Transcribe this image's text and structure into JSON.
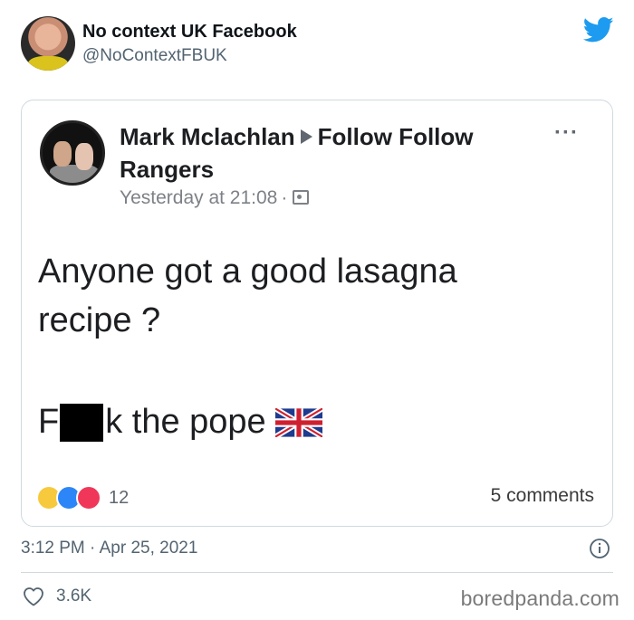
{
  "tweet": {
    "author_name": "No context UK Facebook",
    "author_handle": "@NoContextFBUK",
    "timestamp": "3:12 PM · Apr 25, 2021",
    "likes": "3.6K",
    "brand_color": "#1d9bf0"
  },
  "fb_post": {
    "poster_name": "Mark Mclachlan",
    "group_name": "Follow Follow Rangers",
    "more_label": "···",
    "time": "Yesterday at 21:08",
    "time_separator": "·",
    "text_line1": "Anyone got a good lasagna",
    "text_line2": "recipe ?",
    "text_line3_start": "F",
    "text_line3_end": "k the pope",
    "reaction_count": "12",
    "comments": "5 comments"
  },
  "watermark": "boredpanda.com"
}
